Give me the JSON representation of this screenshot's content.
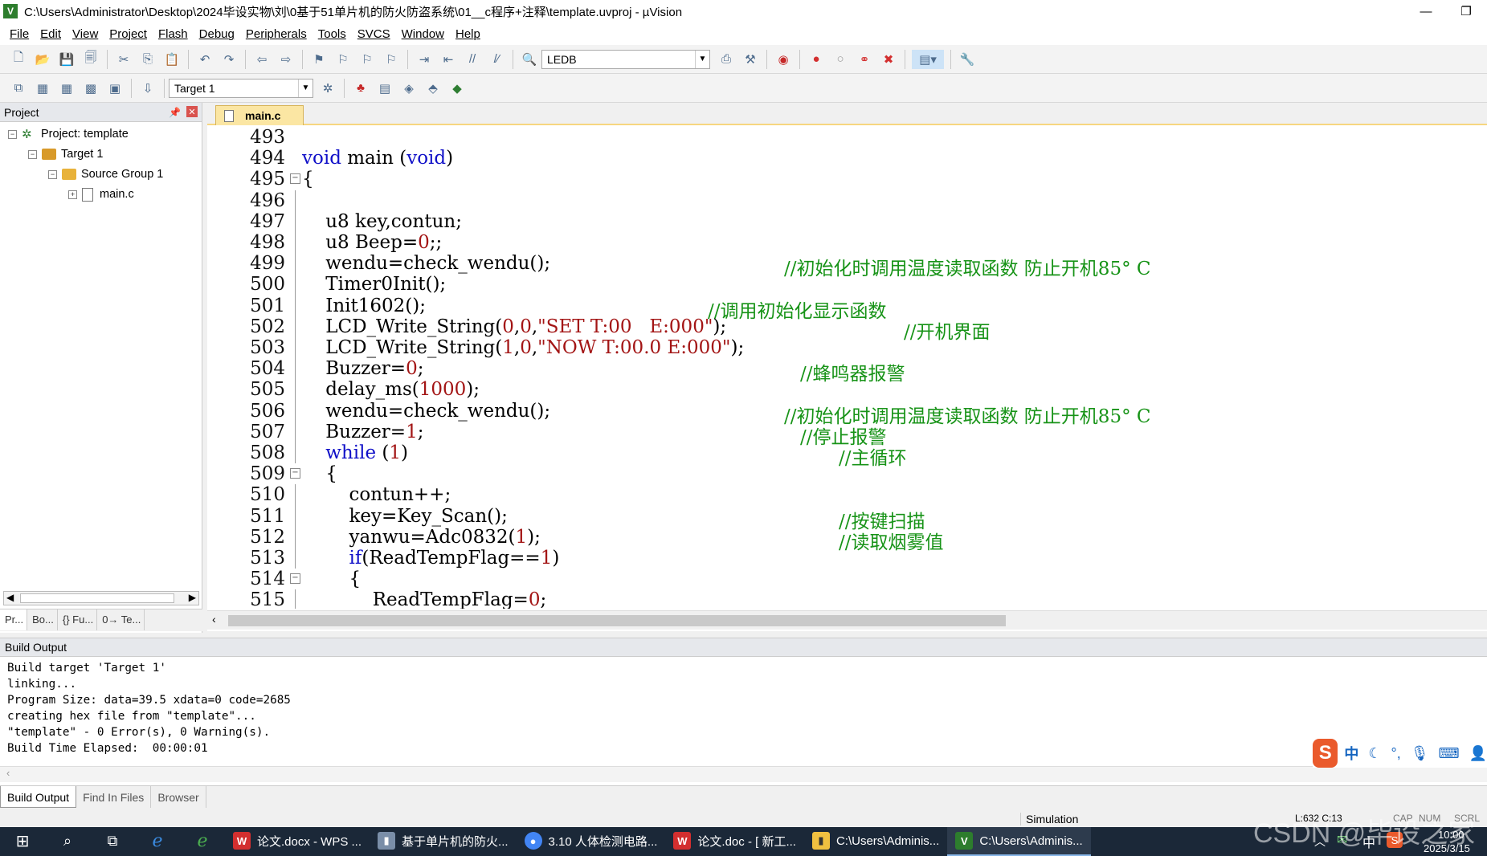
{
  "window": {
    "title": "C:\\Users\\Administrator\\Desktop\\2024毕设实物\\刘\\0基于51单片机的防火防盗系统\\01__c程序+注释\\template.uvproj - µVision",
    "minimize": "—",
    "restore": "❐"
  },
  "menu": [
    "File",
    "Edit",
    "View",
    "Project",
    "Flash",
    "Debug",
    "Peripherals",
    "Tools",
    "SVCS",
    "Window",
    "Help"
  ],
  "toolbar": {
    "find_combo": "LEDB",
    "target_combo": "Target 1"
  },
  "project_panel": {
    "title": "Project",
    "tree": {
      "project": "Project: template",
      "target": "Target 1",
      "group": "Source Group 1",
      "file": "main.c"
    },
    "tabs": [
      "Pr...",
      "Bo...",
      "{} Fu...",
      "0→ Te..."
    ]
  },
  "editor": {
    "tab": "main.c",
    "lines": [
      {
        "n": "493",
        "t": ""
      },
      {
        "n": "494",
        "t": "void main (void)"
      },
      {
        "n": "495",
        "t": "{"
      },
      {
        "n": "496",
        "t": ""
      },
      {
        "n": "497",
        "t": "    u8 key,contun;"
      },
      {
        "n": "498",
        "t": "    u8 Beep=0;;"
      },
      {
        "n": "499",
        "t": "    wendu=check_wendu();",
        "c": "//初始化时调用温度读取函数 防止开机85° C"
      },
      {
        "n": "500",
        "t": "    Timer0Init();"
      },
      {
        "n": "501",
        "t": "    Init1602();",
        "c": "//调用初始化显示函数"
      },
      {
        "n": "502",
        "t": "    LCD_Write_String(0,0,\"SET T:00   E:000\");",
        "c": "//开机界面"
      },
      {
        "n": "503",
        "t": "    LCD_Write_String(1,0,\"NOW T:00.0 E:000\");"
      },
      {
        "n": "504",
        "t": "    Buzzer=0;",
        "c": "//蜂鸣器报警"
      },
      {
        "n": "505",
        "t": "    delay_ms(1000);"
      },
      {
        "n": "506",
        "t": "    wendu=check_wendu();",
        "c": "//初始化时调用温度读取函数 防止开机85° C"
      },
      {
        "n": "507",
        "t": "    Buzzer=1;",
        "c": "//停止报警"
      },
      {
        "n": "508",
        "t": "    while (1)",
        "c": "//主循环"
      },
      {
        "n": "509",
        "t": "    {"
      },
      {
        "n": "510",
        "t": "        contun++;"
      },
      {
        "n": "511",
        "t": "        key=Key_Scan();",
        "c": "//按键扫描"
      },
      {
        "n": "512",
        "t": "        yanwu=Adc0832(1);",
        "c": "//读取烟雾值"
      },
      {
        "n": "513",
        "t": "        if(ReadTempFlag==1)"
      },
      {
        "n": "514",
        "t": "        {"
      },
      {
        "n": "515",
        "t": "            ReadTempFlag=0;"
      }
    ]
  },
  "build_output": {
    "title": "Build Output",
    "lines": [
      "Build target 'Target 1'",
      "linking...",
      "Program Size: data=39.5 xdata=0 code=2685",
      "creating hex file from \"template\"...",
      "\"template\" - 0 Error(s), 0 Warning(s).",
      "Build Time Elapsed:  00:00:01"
    ],
    "tabs": [
      "Build Output",
      "Find In Files",
      "Browser"
    ]
  },
  "status": {
    "mode": "Simulation",
    "position": "L:632 C:13",
    "caps": "CAP",
    "num": "NUM",
    "scrl": "SCRL"
  },
  "ime": {
    "logo": "S",
    "lang": "中"
  },
  "taskbar": {
    "items": [
      {
        "label": "论文.docx - WPS ...",
        "color": "#d32f2f",
        "icon": "W"
      },
      {
        "label": "基于单片机的防火...",
        "color": "#7a8ea8",
        "icon": "▮"
      },
      {
        "label": "3.10 人体检测电路...",
        "color": "#4285f4",
        "icon": "●"
      },
      {
        "label": "论文.doc - [ 新工...",
        "color": "#d32f2f",
        "icon": "W"
      },
      {
        "label": "C:\\Users\\Adminis...",
        "color": "#f0c040",
        "icon": "▮"
      },
      {
        "label": "C:\\Users\\Adminis...",
        "color": "#2d7d2d",
        "icon": "V"
      }
    ],
    "tray_lang": "中",
    "time": "10:00",
    "date": "2025/3/15"
  },
  "watermark": "CSDN @毕设之家"
}
